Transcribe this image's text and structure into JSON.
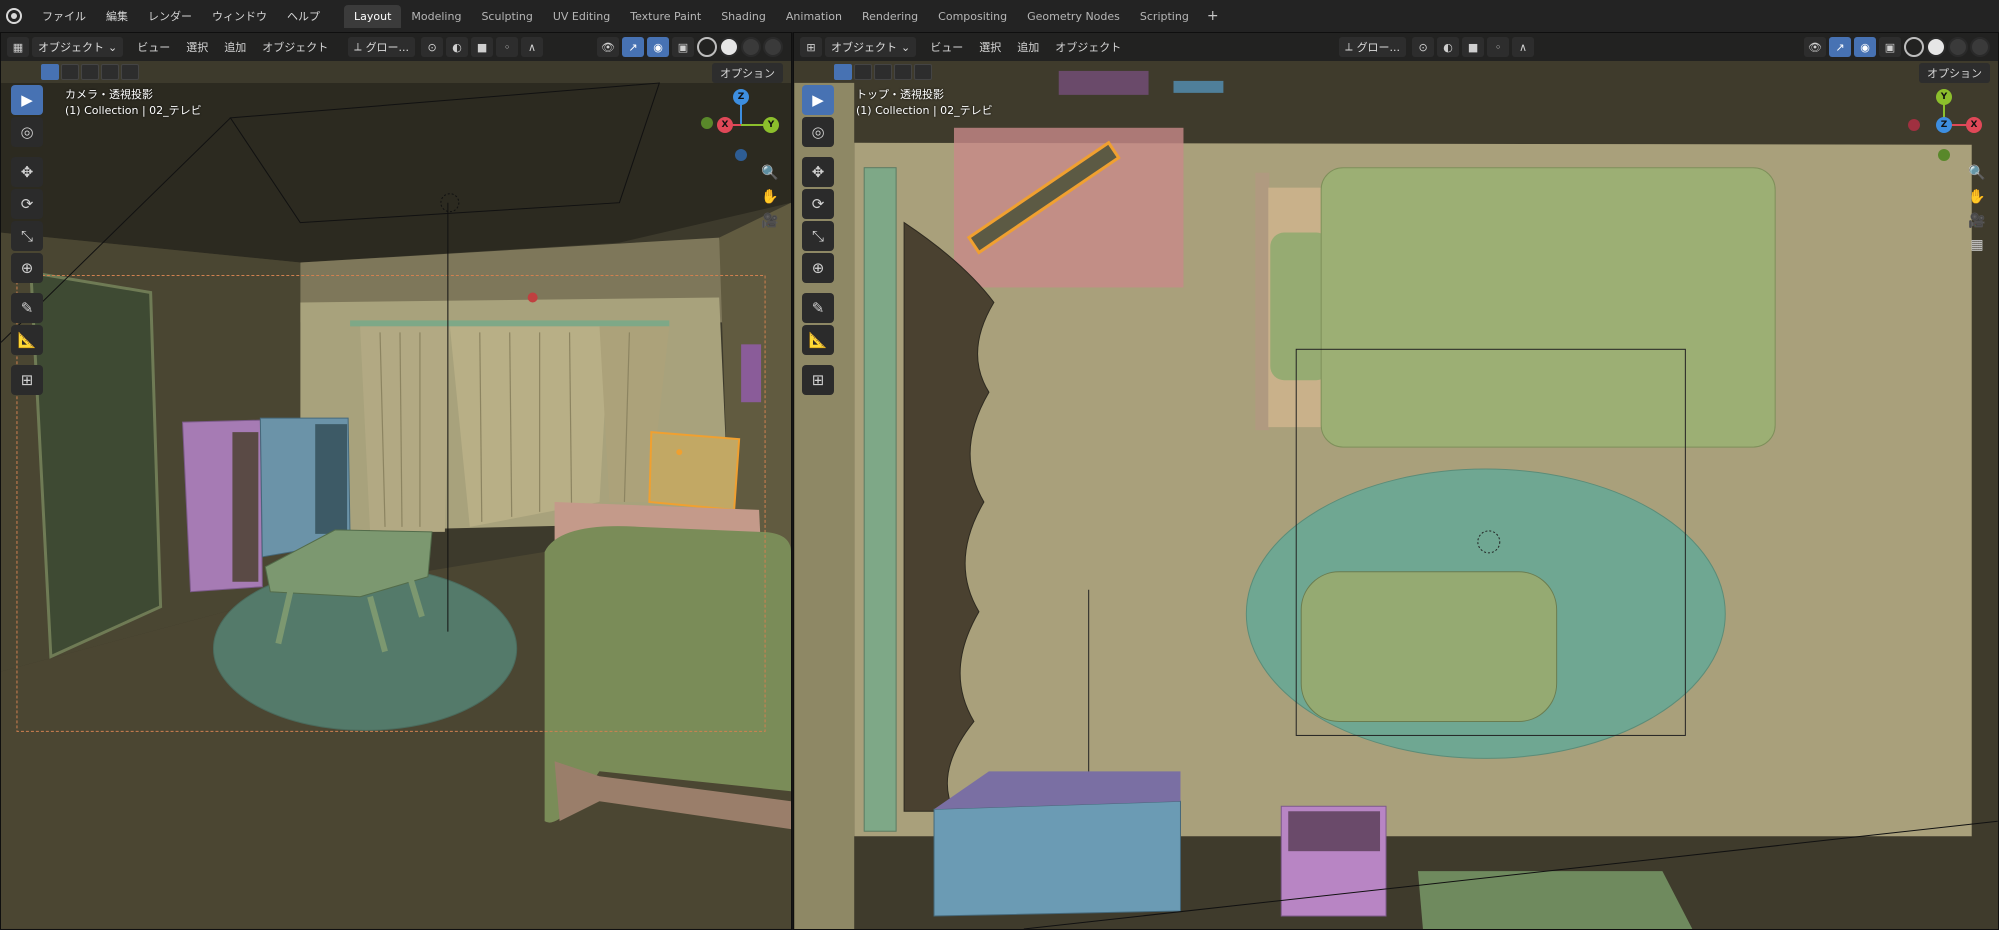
{
  "menubar": {
    "items": [
      "ファイル",
      "編集",
      "レンダー",
      "ウィンドウ",
      "ヘルプ"
    ],
    "workspaces": [
      "Layout",
      "Modeling",
      "Sculpting",
      "UV Editing",
      "Texture Paint",
      "Shading",
      "Animation",
      "Rendering",
      "Compositing",
      "Geometry Nodes",
      "Scripting"
    ],
    "active_workspace": "Layout",
    "add_tab": "+"
  },
  "left_viewport": {
    "mode": "オブジェクト",
    "menus": [
      "ビュー",
      "選択",
      "追加",
      "オブジェクト"
    ],
    "transform_orientation": "グロー...",
    "options": "オプション",
    "view_label": "カメラ・透視投影",
    "collection_label": "(1) Collection | 02_テレビ"
  },
  "right_viewport": {
    "mode": "オブジェクト",
    "menus": [
      "ビュー",
      "選択",
      "追加",
      "オブジェクト"
    ],
    "transform_orientation": "グロー...",
    "options": "オプション",
    "view_label": "トップ・透視投影",
    "collection_label": "(1) Collection | 02_テレビ"
  },
  "gizmo": {
    "x": "X",
    "y": "Y",
    "z": "Z"
  },
  "tools": [
    "select-box",
    "cursor",
    "move",
    "rotate",
    "scale",
    "transform",
    "annotate",
    "measure",
    "add-cube"
  ],
  "icons": {
    "select": "▶",
    "cursor": "◎",
    "move": "✥",
    "rotate": "⟳",
    "scale": "⤡",
    "transform": "⊕",
    "annotate": "✎",
    "measure": "📐",
    "add": "⊞",
    "zoom": "🔍",
    "hand": "✋",
    "camera": "🎥",
    "grid": "▦"
  },
  "colors": {
    "accent": "#4772b3",
    "axis_x": "#e04858",
    "axis_y": "#8cbf2c",
    "axis_z": "#3d8ee0",
    "selection": "#f0a030"
  }
}
